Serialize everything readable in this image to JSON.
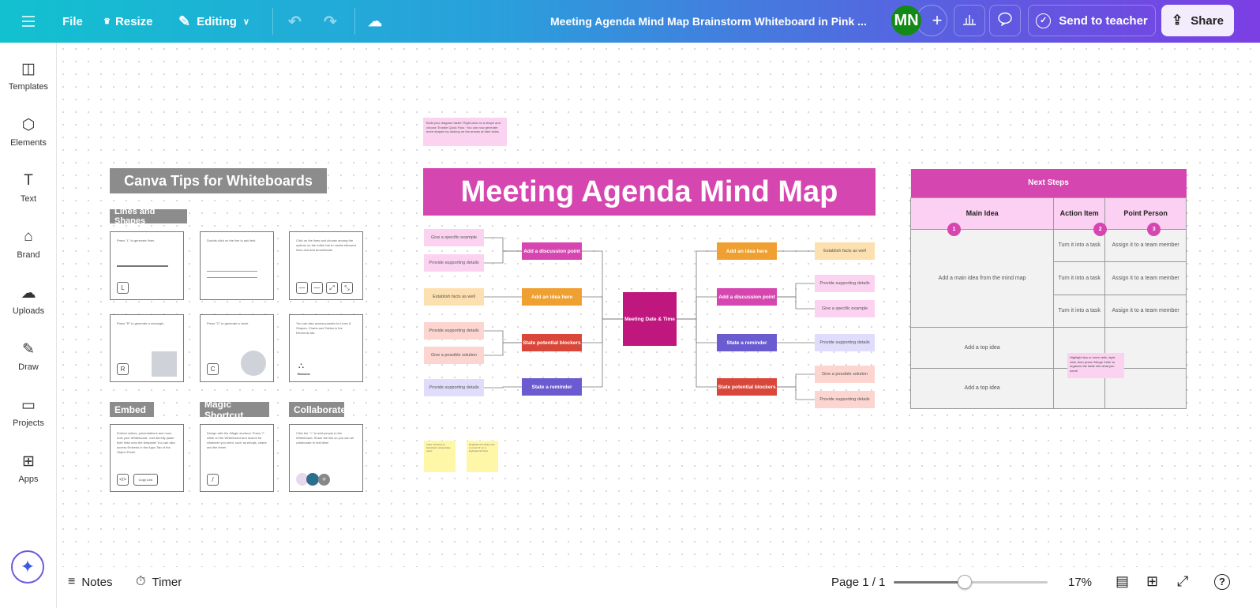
{
  "topbar": {
    "file": "File",
    "resize": "Resize",
    "editing": "Editing",
    "title": "Meeting Agenda Mind Map Brainstorm Whiteboard in Pink ...",
    "avatar": "MN",
    "send": "Send to teacher",
    "share": "Share",
    "icons": [
      "menu-icon",
      "crown-icon",
      "pencil-icon",
      "chevron-down-icon",
      "undo-icon",
      "redo-icon",
      "cloud-check-icon",
      "plus-icon",
      "bar-chart-icon",
      "comment-icon",
      "check-circle-icon",
      "upload-icon"
    ]
  },
  "sidebar": {
    "items": [
      {
        "label": "Templates",
        "icon": "templates-icon"
      },
      {
        "label": "Elements",
        "icon": "elements-icon"
      },
      {
        "label": "Text",
        "icon": "text-icon"
      },
      {
        "label": "Brand",
        "icon": "brand-icon"
      },
      {
        "label": "Uploads",
        "icon": "cloud-upload-icon"
      },
      {
        "label": "Draw",
        "icon": "draw-icon"
      },
      {
        "label": "Projects",
        "icon": "folder-icon"
      },
      {
        "label": "Apps",
        "icon": "apps-icon"
      }
    ]
  },
  "bottombar": {
    "notes": "Notes",
    "timer": "Timer",
    "page": "Page 1 / 1",
    "zoom": "17%",
    "zoom_slider_percent": 17
  },
  "tips": {
    "title": "Canva Tips for Whiteboards",
    "lines_shapes": "Lines and Shapes",
    "embed": "Embed",
    "magic": "Magic Shortcut",
    "collaborate": "Collaborate",
    "cards": [
      "Press \"L\" to generate lines.",
      "Double-click on the line to add text.",
      "Click on the lines and choose among the options on the editor bar to create elbowed lines and add arrowheads.",
      "Press \"R\" to generate a rectangle.",
      "Press \"C\" to generate a circle.",
      "You can also access panels for Lines & Shapes, Charts and Tables in the Elements tab.",
      "Embed videos, presentations and more onto your Whiteboard. Just directly paste their links onto the template! You can also access Embeds in the Apps Tab of the Object Panel.",
      "Design with the /Magic shortcut. Press \"/\" while on the Whiteboard and search for whatever you need, such as emojis, charts and the timer!",
      "Click the \"+\" to add people to the Whiteboard. Share the link so you can all collaborate in real time!"
    ],
    "keys": [
      "L",
      "R",
      "C",
      "</>",
      "Copy Link",
      "/"
    ],
    "elements_label": "Elements"
  },
  "hint": "Build your diagram faster! Right-click on a shape and choose 'Enable Quick Flow.' You can now generate more shapes by clicking on the arrows at their sides.",
  "mindmap": {
    "title": "Meeting Agenda Mind Map",
    "center": "Meeting Date & Time",
    "colors": {
      "title": "#d646b0",
      "center": "#c0177f",
      "magenta": "#d646b0",
      "orange": "#f0a030",
      "red": "#d9473a",
      "purple": "#6b5bd0",
      "pink_light": "#fbd3f0",
      "orange_light": "#fde0b0",
      "salmon_light": "#fdd5d0",
      "lavender_light": "#e0dcfc"
    },
    "left_main": [
      {
        "label": "Add a discussion point",
        "color": "magenta"
      },
      {
        "label": "Add an idea here",
        "color": "orange"
      },
      {
        "label": "State potential blockers",
        "color": "red"
      },
      {
        "label": "State a reminder",
        "color": "purple"
      }
    ],
    "left_sub": [
      {
        "label": "Give a specific example",
        "color": "pink_light"
      },
      {
        "label": "Provide supporting details",
        "color": "pink_light"
      },
      {
        "label": "Establish facts as well",
        "color": "orange_light"
      },
      {
        "label": "Provide supporting details",
        "color": "salmon_light"
      },
      {
        "label": "Give a possible solution",
        "color": "salmon_light"
      },
      {
        "label": "Provide supporting details",
        "color": "lavender_light"
      }
    ],
    "right_main": [
      {
        "label": "Add an idea here",
        "color": "orange"
      },
      {
        "label": "Add a discussion point",
        "color": "magenta"
      },
      {
        "label": "State a reminder",
        "color": "purple"
      },
      {
        "label": "State potential blockers",
        "color": "red"
      }
    ],
    "right_sub": [
      {
        "label": "Establish facts as well",
        "color": "orange_light"
      },
      {
        "label": "Provide supporting details",
        "color": "pink_light"
      },
      {
        "label": "Give a specific example",
        "color": "pink_light"
      },
      {
        "label": "Provide supporting details",
        "color": "lavender_light"
      },
      {
        "label": "Give a possible solution",
        "color": "salmon_light"
      },
      {
        "label": "Provide supporting details",
        "color": "salmon_light"
      }
    ]
  },
  "stickies": [
    "Invite members to brainstorm using sticky notes",
    "Duplicate the sticky note or press 'S' on a keyboard shortcut"
  ],
  "table": {
    "title": "Next Steps",
    "headers": [
      "Main Idea",
      "Action Item",
      "Point Person"
    ],
    "numbers": [
      "1",
      "2",
      "3"
    ],
    "main_idea": "Add a main idea from the mind map",
    "task": "Turn it into a task",
    "person": "Assign it to a team member",
    "top_idea": "Add a top idea",
    "tip": "Highlight two or more cells, right-click, then press 'Merge Cells' to organize the table into what you need!"
  }
}
